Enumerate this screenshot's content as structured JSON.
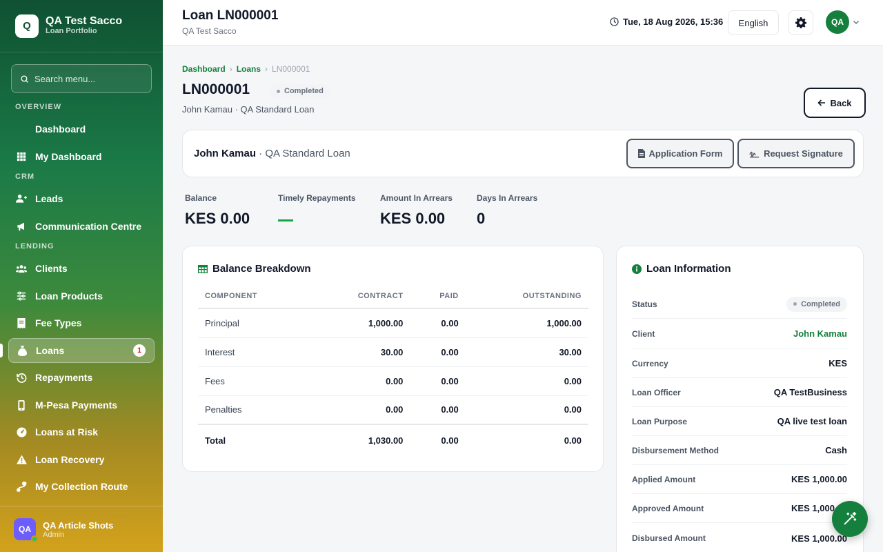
{
  "brand": {
    "logo": "Q",
    "name": "QA Test Sacco",
    "subtitle": "Loan Portfolio"
  },
  "search": {
    "placeholder": "Search menu..."
  },
  "sections": {
    "overview": "OVERVIEW",
    "crm": "CRM",
    "lending": "LENDING"
  },
  "nav": {
    "dashboard": "Dashboard",
    "my_dashboard": "My Dashboard",
    "leads": "Leads",
    "communication": "Communication Centre",
    "clients": "Clients",
    "loan_products": "Loan Products",
    "fee_types": "Fee Types",
    "loans": "Loans",
    "loans_badge": "1",
    "repayments": "Repayments",
    "mpesa": "M-Pesa Payments",
    "loans_at_risk": "Loans at Risk",
    "loan_recovery": "Loan Recovery",
    "collection_route": "My Collection Route"
  },
  "user": {
    "initials": "QA",
    "name": "QA Article Shots",
    "role": "Admin"
  },
  "topbar": {
    "title": "Loan LN000001",
    "subtitle": "QA Test Sacco",
    "datetime": "Tue, 18 Aug 2026, 15:36",
    "language": "English",
    "avatar": "QA"
  },
  "breadcrumb": {
    "home": "Dashboard",
    "section": "Loans",
    "current": "LN000001"
  },
  "page": {
    "title": "LN000001",
    "status": "Completed",
    "subtitle": "John Kamau · QA Standard Loan",
    "back_label": "Back"
  },
  "header_card": {
    "client": "John Kamau",
    "product": " · QA Standard Loan",
    "application_form": "Application Form",
    "request_signature": "Request Signature"
  },
  "stats": {
    "balance_label": "Balance",
    "balance_value": "KES 0.00",
    "timely_label": "Timely Repayments",
    "timely_value": "—",
    "arrears_label": "Amount In Arrears",
    "arrears_value": "KES 0.00",
    "days_label": "Days In Arrears",
    "days_value": "0"
  },
  "breakdown": {
    "title": "Balance Breakdown",
    "columns": [
      "COMPONENT",
      "CONTRACT",
      "PAID",
      "OUTSTANDING"
    ],
    "rows": [
      [
        "Principal",
        "1,000.00",
        "0.00",
        "1,000.00"
      ],
      [
        "Interest",
        "30.00",
        "0.00",
        "30.00"
      ],
      [
        "Fees",
        "0.00",
        "0.00",
        "0.00"
      ],
      [
        "Penalties",
        "0.00",
        "0.00",
        "0.00"
      ]
    ],
    "total": [
      "Total",
      "1,030.00",
      "0.00",
      "0.00"
    ]
  },
  "loan_info": {
    "title": "Loan Information",
    "status_label": "Status",
    "status_value": "Completed",
    "client_label": "Client",
    "client_value": "John Kamau",
    "currency_label": "Currency",
    "currency_value": "KES",
    "officer_label": "Loan Officer",
    "officer_value": "QA TestBusiness",
    "purpose_label": "Loan Purpose",
    "purpose_value": "QA live test loan",
    "method_label": "Disbursement Method",
    "method_value": "Cash",
    "applied_label": "Applied Amount",
    "applied_value": "KES 1,000.00",
    "approved_label": "Approved Amount",
    "approved_value": "KES 1,000.00",
    "disbursed_label": "Disbursed Amount",
    "disbursed_value": "KES 1,000.00"
  },
  "colors": {
    "brand_green": "#15803d",
    "sidebar_top": "#0f5132",
    "sidebar_bottom": "#d4a21c"
  },
  "icons": {
    "fab": "magic-wand-icon",
    "gear": "gear-icon",
    "clock": "clock-icon"
  }
}
